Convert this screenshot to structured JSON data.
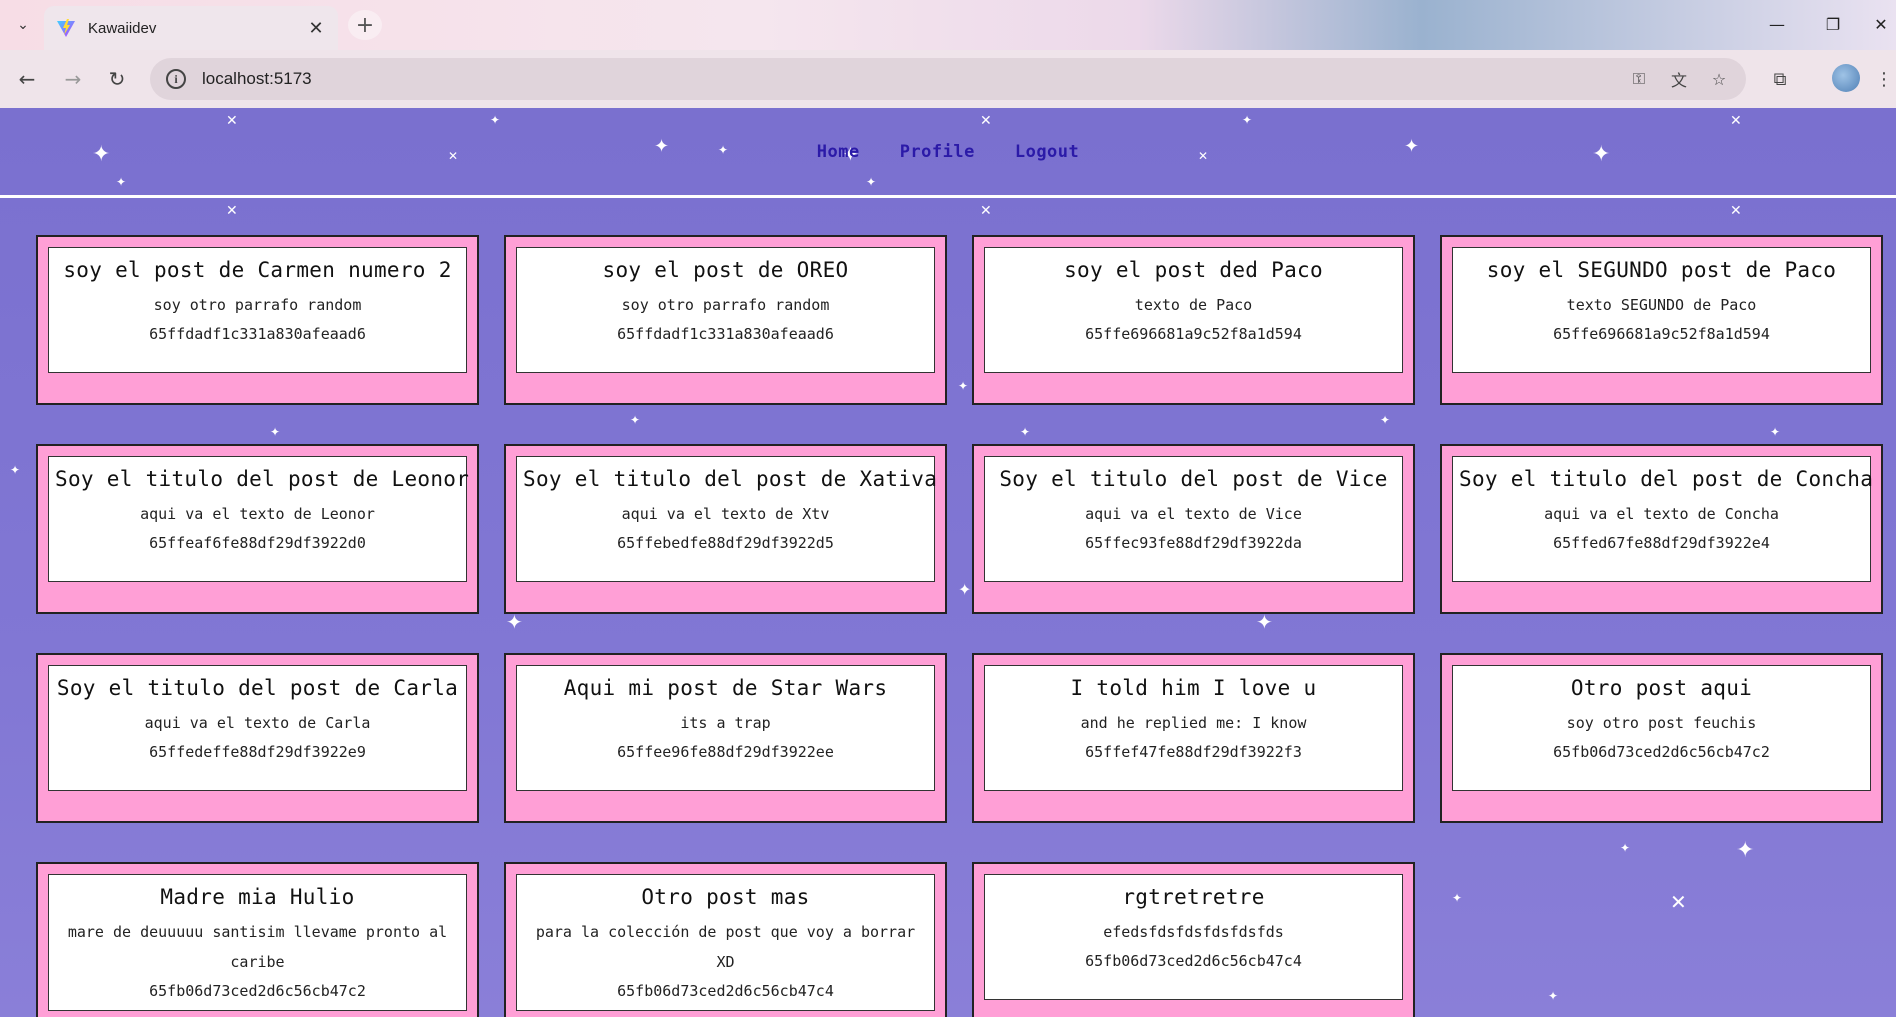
{
  "browser": {
    "tab_title": "Kawaiidev",
    "url": "localhost:5173",
    "icons": [
      "chevron-down-icon",
      "vite-favicon-icon",
      "close-icon",
      "plus-icon",
      "minimize-icon",
      "maximize-icon",
      "close-window-icon",
      "back-icon",
      "forward-icon",
      "reload-icon",
      "info-icon",
      "password-key-icon",
      "translate-icon",
      "star-icon",
      "extensions-icon",
      "menu-dots-icon"
    ]
  },
  "nav": {
    "home": "Home",
    "profile": "Profile",
    "logout": "Logout"
  },
  "posts": [
    {
      "title": "soy el post de Carmen numero 2",
      "text": "soy otro parrafo random",
      "id": "65ffdadf1c331a830afeaad6"
    },
    {
      "title": "soy el post de OREO",
      "text": "soy otro parrafo random",
      "id": "65ffdadf1c331a830afeaad6"
    },
    {
      "title": "soy el post ded Paco",
      "text": "texto de Paco",
      "id": "65ffe696681a9c52f8a1d594"
    },
    {
      "title": "soy el SEGUNDO post de Paco",
      "text": "texto SEGUNDO de Paco",
      "id": "65ffe696681a9c52f8a1d594"
    },
    {
      "title": "Soy el titulo del post de Leonor",
      "text": "aqui va el texto de Leonor",
      "id": "65ffeaf6fe88df29df3922d0"
    },
    {
      "title": "Soy el titulo del post de Xativa",
      "text": "aqui va el texto de Xtv",
      "id": "65ffebedfe88df29df3922d5"
    },
    {
      "title": "Soy el titulo del post de Vice",
      "text": "aqui va el texto de Vice",
      "id": "65ffec93fe88df29df3922da"
    },
    {
      "title": "Soy el titulo del post de Concha",
      "text": "aqui va el texto de Concha",
      "id": "65ffed67fe88df29df3922e4"
    },
    {
      "title": "Soy el titulo del post de Carla",
      "text": "aqui va el texto de Carla",
      "id": "65ffedeffe88df29df3922e9"
    },
    {
      "title": "Aqui mi post de Star Wars",
      "text": "its a trap",
      "id": "65ffee96fe88df29df3922ee"
    },
    {
      "title": "I told him I love u",
      "text": "and he replied me: I know",
      "id": "65ffef47fe88df29df3922f3"
    },
    {
      "title": "Otro post aqui",
      "text": "soy otro post feuchis",
      "id": "65fb06d73ced2d6c56cb47c2"
    },
    {
      "title": "Madre mia Hulio",
      "text": "mare de deuuuuu santisim llevame pronto al caribe",
      "id": "65fb06d73ced2d6c56cb47c2"
    },
    {
      "title": "Otro post mas",
      "text": "para la colección de post que voy a borrar XD",
      "id": "65fb06d73ced2d6c56cb47c4"
    },
    {
      "title": "rgtretretre",
      "text": "efedsfdsfdsfdsfdsfds",
      "id": "65fb06d73ced2d6c56cb47c4"
    }
  ],
  "colors": {
    "page_bg": "#7b74cc",
    "card_bg": "#ff9fd6",
    "nav_link": "#2b1aa8"
  }
}
